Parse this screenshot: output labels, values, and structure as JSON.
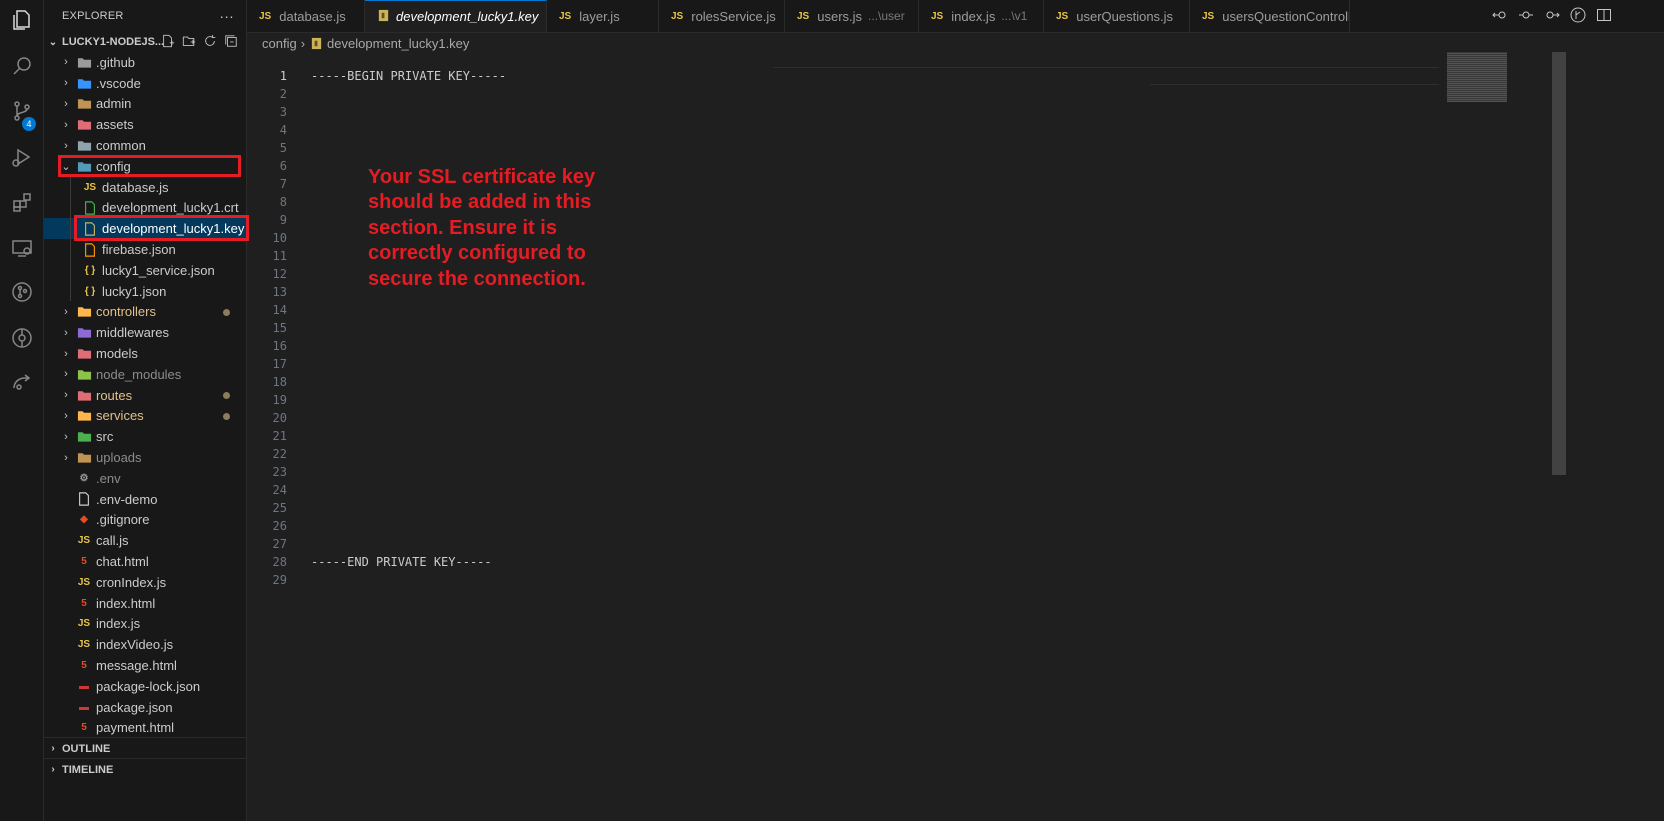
{
  "explorer": {
    "title": "EXPLORER",
    "more": "···",
    "root": "LUCKY1-NODEJS...",
    "tree": [
      {
        "label": ".github",
        "type": "folder",
        "icon": "github-folder-icon",
        "color": "#9b9b9b",
        "level": 0
      },
      {
        "label": ".vscode",
        "type": "folder",
        "icon": "vscode-folder-icon",
        "color": "#3794ff",
        "level": 0
      },
      {
        "label": "admin",
        "type": "folder",
        "icon": "folder-icon",
        "color": "#c09553",
        "level": 0
      },
      {
        "label": "assets",
        "type": "folder",
        "icon": "assets-folder-icon",
        "color": "#e06c75",
        "level": 0
      },
      {
        "label": "common",
        "type": "folder",
        "icon": "common-folder-icon",
        "color": "#90a4ae",
        "level": 0
      },
      {
        "label": "config",
        "type": "folder-open",
        "icon": "config-folder-icon",
        "color": "#519aba",
        "level": 0
      },
      {
        "label": "database.js",
        "type": "file",
        "icon": "js-file-icon",
        "glyph": "JS",
        "color": "#e8c547",
        "level": 1
      },
      {
        "label": "development_lucky1.crt",
        "type": "file",
        "icon": "certificate-file-icon",
        "color": "#4caf50",
        "level": 1
      },
      {
        "label": "development_lucky1.key",
        "type": "file",
        "icon": "key-file-icon",
        "color": "#cbb35b",
        "level": 1,
        "selected": true
      },
      {
        "label": "firebase.json",
        "type": "file",
        "icon": "firebase-file-icon",
        "color": "#ff9800",
        "level": 1
      },
      {
        "label": "lucky1_service.json",
        "type": "file",
        "icon": "json-file-icon",
        "glyph": "{ }",
        "color": "#e8c547",
        "level": 1
      },
      {
        "label": "lucky1.json",
        "type": "file",
        "icon": "json-file-icon",
        "glyph": "{ }",
        "color": "#e8c547",
        "level": 1
      },
      {
        "label": "controllers",
        "type": "folder",
        "icon": "controllers-folder-icon",
        "color": "#ffb74d",
        "level": 0,
        "modified": true
      },
      {
        "label": "middlewares",
        "type": "folder",
        "icon": "middlewares-folder-icon",
        "color": "#8c6bd6",
        "level": 0
      },
      {
        "label": "models",
        "type": "folder",
        "icon": "models-folder-icon",
        "color": "#e06c75",
        "level": 0
      },
      {
        "label": "node_modules",
        "type": "folder",
        "icon": "node-modules-folder-icon",
        "color": "#8bc34a",
        "level": 0,
        "dim": true
      },
      {
        "label": "routes",
        "type": "folder",
        "icon": "routes-folder-icon",
        "color": "#e06c75",
        "level": 0,
        "modified": true
      },
      {
        "label": "services",
        "type": "folder",
        "icon": "services-folder-icon",
        "color": "#ffb74d",
        "level": 0,
        "modified": true
      },
      {
        "label": "src",
        "type": "folder",
        "icon": "src-folder-icon",
        "color": "#4caf50",
        "level": 0
      },
      {
        "label": "uploads",
        "type": "folder",
        "icon": "uploads-folder-icon",
        "color": "#c09553",
        "level": 0,
        "dim": true
      },
      {
        "label": ".env",
        "type": "file",
        "icon": "gear-icon",
        "glyph": "⚙",
        "color": "#9b9b9b",
        "level": 0,
        "dim": true
      },
      {
        "label": ".env-demo",
        "type": "file",
        "icon": "file-icon",
        "color": "#cccccc",
        "level": 0
      },
      {
        "label": ".gitignore",
        "type": "file",
        "icon": "git-file-icon",
        "glyph": "◆",
        "color": "#e44d26",
        "level": 0
      },
      {
        "label": "call.js",
        "type": "file",
        "icon": "js-file-icon",
        "glyph": "JS",
        "color": "#e8c547",
        "level": 0
      },
      {
        "label": "chat.html",
        "type": "file",
        "icon": "html-file-icon",
        "glyph": "5",
        "color": "#e44d26",
        "level": 0
      },
      {
        "label": "cronIndex.js",
        "type": "file",
        "icon": "js-file-icon",
        "glyph": "JS",
        "color": "#e8c547",
        "level": 0
      },
      {
        "label": "index.html",
        "type": "file",
        "icon": "html-file-icon",
        "glyph": "5",
        "color": "#e44d26",
        "level": 0
      },
      {
        "label": "index.js",
        "type": "file",
        "icon": "js-file-icon",
        "glyph": "JS",
        "color": "#e8c547",
        "level": 0
      },
      {
        "label": "indexVideo.js",
        "type": "file",
        "icon": "js-file-icon",
        "glyph": "JS",
        "color": "#e8c547",
        "level": 0
      },
      {
        "label": "message.html",
        "type": "file",
        "icon": "html-file-icon",
        "glyph": "5",
        "color": "#e44d26",
        "level": 0
      },
      {
        "label": "package-lock.json",
        "type": "file",
        "icon": "npm-file-icon",
        "glyph": "▬",
        "color": "#cb3837",
        "level": 0
      },
      {
        "label": "package.json",
        "type": "file",
        "icon": "npm-file-icon",
        "glyph": "▬",
        "color": "#cb3837",
        "level": 0
      },
      {
        "label": "payment.html",
        "type": "file",
        "icon": "html-file-icon",
        "glyph": "5",
        "color": "#e44d26",
        "level": 0
      }
    ],
    "outline": "OUTLINE",
    "timeline": "TIMELINE"
  },
  "source_control_badge": "4",
  "tabs": [
    {
      "label": "database.js",
      "glyph": "JS",
      "desc": ""
    },
    {
      "label": "development_lucky1.key",
      "glyph": "",
      "desc": "",
      "active": true
    },
    {
      "label": "layer.js",
      "glyph": "JS",
      "desc": ""
    },
    {
      "label": "rolesService.js",
      "glyph": "JS",
      "desc": ""
    },
    {
      "label": "users.js",
      "glyph": "JS",
      "desc": "...\\user"
    },
    {
      "label": "index.js",
      "glyph": "JS",
      "desc": "...\\v1"
    },
    {
      "label": "userQuestions.js",
      "glyph": "JS",
      "desc": ""
    },
    {
      "label": "usersQuestionController.js",
      "glyph": "JS",
      "desc": ""
    }
  ],
  "tab_close": "×",
  "breadcrumb": {
    "folder": "config",
    "separator": "›",
    "file": "development_lucky1.key"
  },
  "editor": {
    "line_count": 29,
    "current_line": 1,
    "lines": {
      "1": "-----BEGIN PRIVATE KEY-----",
      "28": "-----END PRIVATE KEY-----"
    },
    "annotation": "Your SSL certificate key should be added in this section. Ensure it is correctly configured to secure the connection."
  },
  "colors": {
    "highlight": "#e51c23",
    "accent": "#0078d4",
    "selection": "#04395e"
  }
}
